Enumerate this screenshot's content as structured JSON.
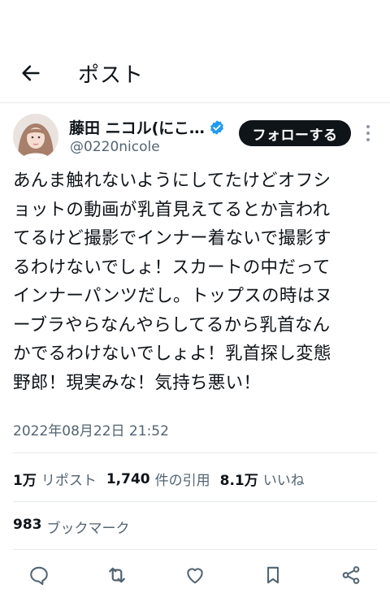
{
  "header": {
    "title": "ポスト"
  },
  "user": {
    "display_name": "藤田 ニコル(にこ…",
    "handle": "@0220nicole"
  },
  "follow_label": "フォローする",
  "tweet": {
    "lines": [
      "あんま触れないようにしてたけどオフシ",
      "ョットの動画が乳首見えてるとか言われ",
      "てるけど撮影でインナー着ないで撮影す",
      "るわけないでしょ！スカートの中だって",
      "インナーパンツだし。トップスの時はヌ",
      "ーブラやらなんやらしてるから乳首なん",
      "かでるわけないでしょよ！乳首探し変態",
      "野郎！現実みな！気持ち悪い！"
    ],
    "timestamp": "2022年08月22日 21:52"
  },
  "stats": {
    "reposts_count": "1万",
    "reposts_label": "リポスト",
    "quotes_count": "1,740",
    "quotes_label": "件の引用",
    "likes_count": "8.1万",
    "likes_label": "いいね",
    "bookmarks_count": "983",
    "bookmarks_label": "ブックマーク"
  },
  "colors": {
    "verified": "#1d9bf0",
    "text": "#0f1419",
    "muted": "#536471"
  },
  "icons": [
    "back-arrow-icon",
    "verified-badge-icon",
    "more-vertical-icon",
    "reply-icon",
    "repost-icon",
    "like-icon",
    "bookmark-icon",
    "share-icon"
  ]
}
